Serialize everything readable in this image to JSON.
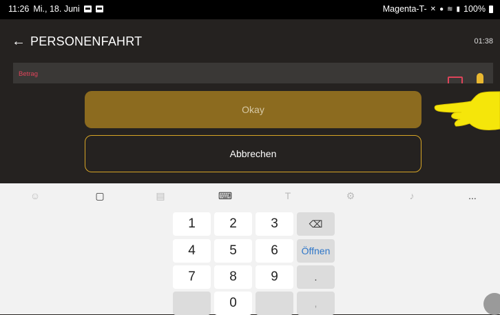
{
  "status_bar": {
    "time": "11:26",
    "date": "Mi., 18. Juni",
    "carrier": "Magenta-T-",
    "battery": "100%"
  },
  "app_bar": {
    "title": "PERSONENFAHRT",
    "timer": "01:38"
  },
  "amount_field": {
    "label": "Betrag"
  },
  "buttons": {
    "okay": "Okay",
    "cancel": "Abbrechen"
  },
  "keyboard": {
    "toolbar_more": "...",
    "keys": [
      "1",
      "2",
      "3",
      "4",
      "5",
      "6",
      "7",
      "8",
      "9",
      "0"
    ],
    "open_label": "Öffnen",
    "period": ".",
    "comma": ","
  },
  "colors": {
    "background": "#252220",
    "okay_button": "#8c6b1f",
    "cancel_border": "#d8a626",
    "label_red": "#e0445a",
    "hand_yellow": "#f5e60a"
  }
}
